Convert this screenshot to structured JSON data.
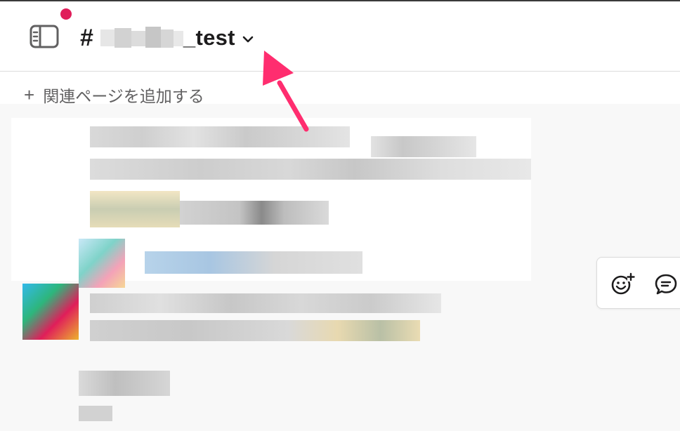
{
  "header": {
    "channel_prefix": "#",
    "channel_name_suffix": "_test",
    "notification_color": "#e01e5a"
  },
  "bookmarks": {
    "add_label": "関連ページを追加する",
    "add_icon": "+"
  },
  "message_actions": {
    "items": [
      "add-reaction-icon",
      "reply-in-thread-icon"
    ]
  },
  "annotation": {
    "arrow_color": "#ff2d6f"
  }
}
